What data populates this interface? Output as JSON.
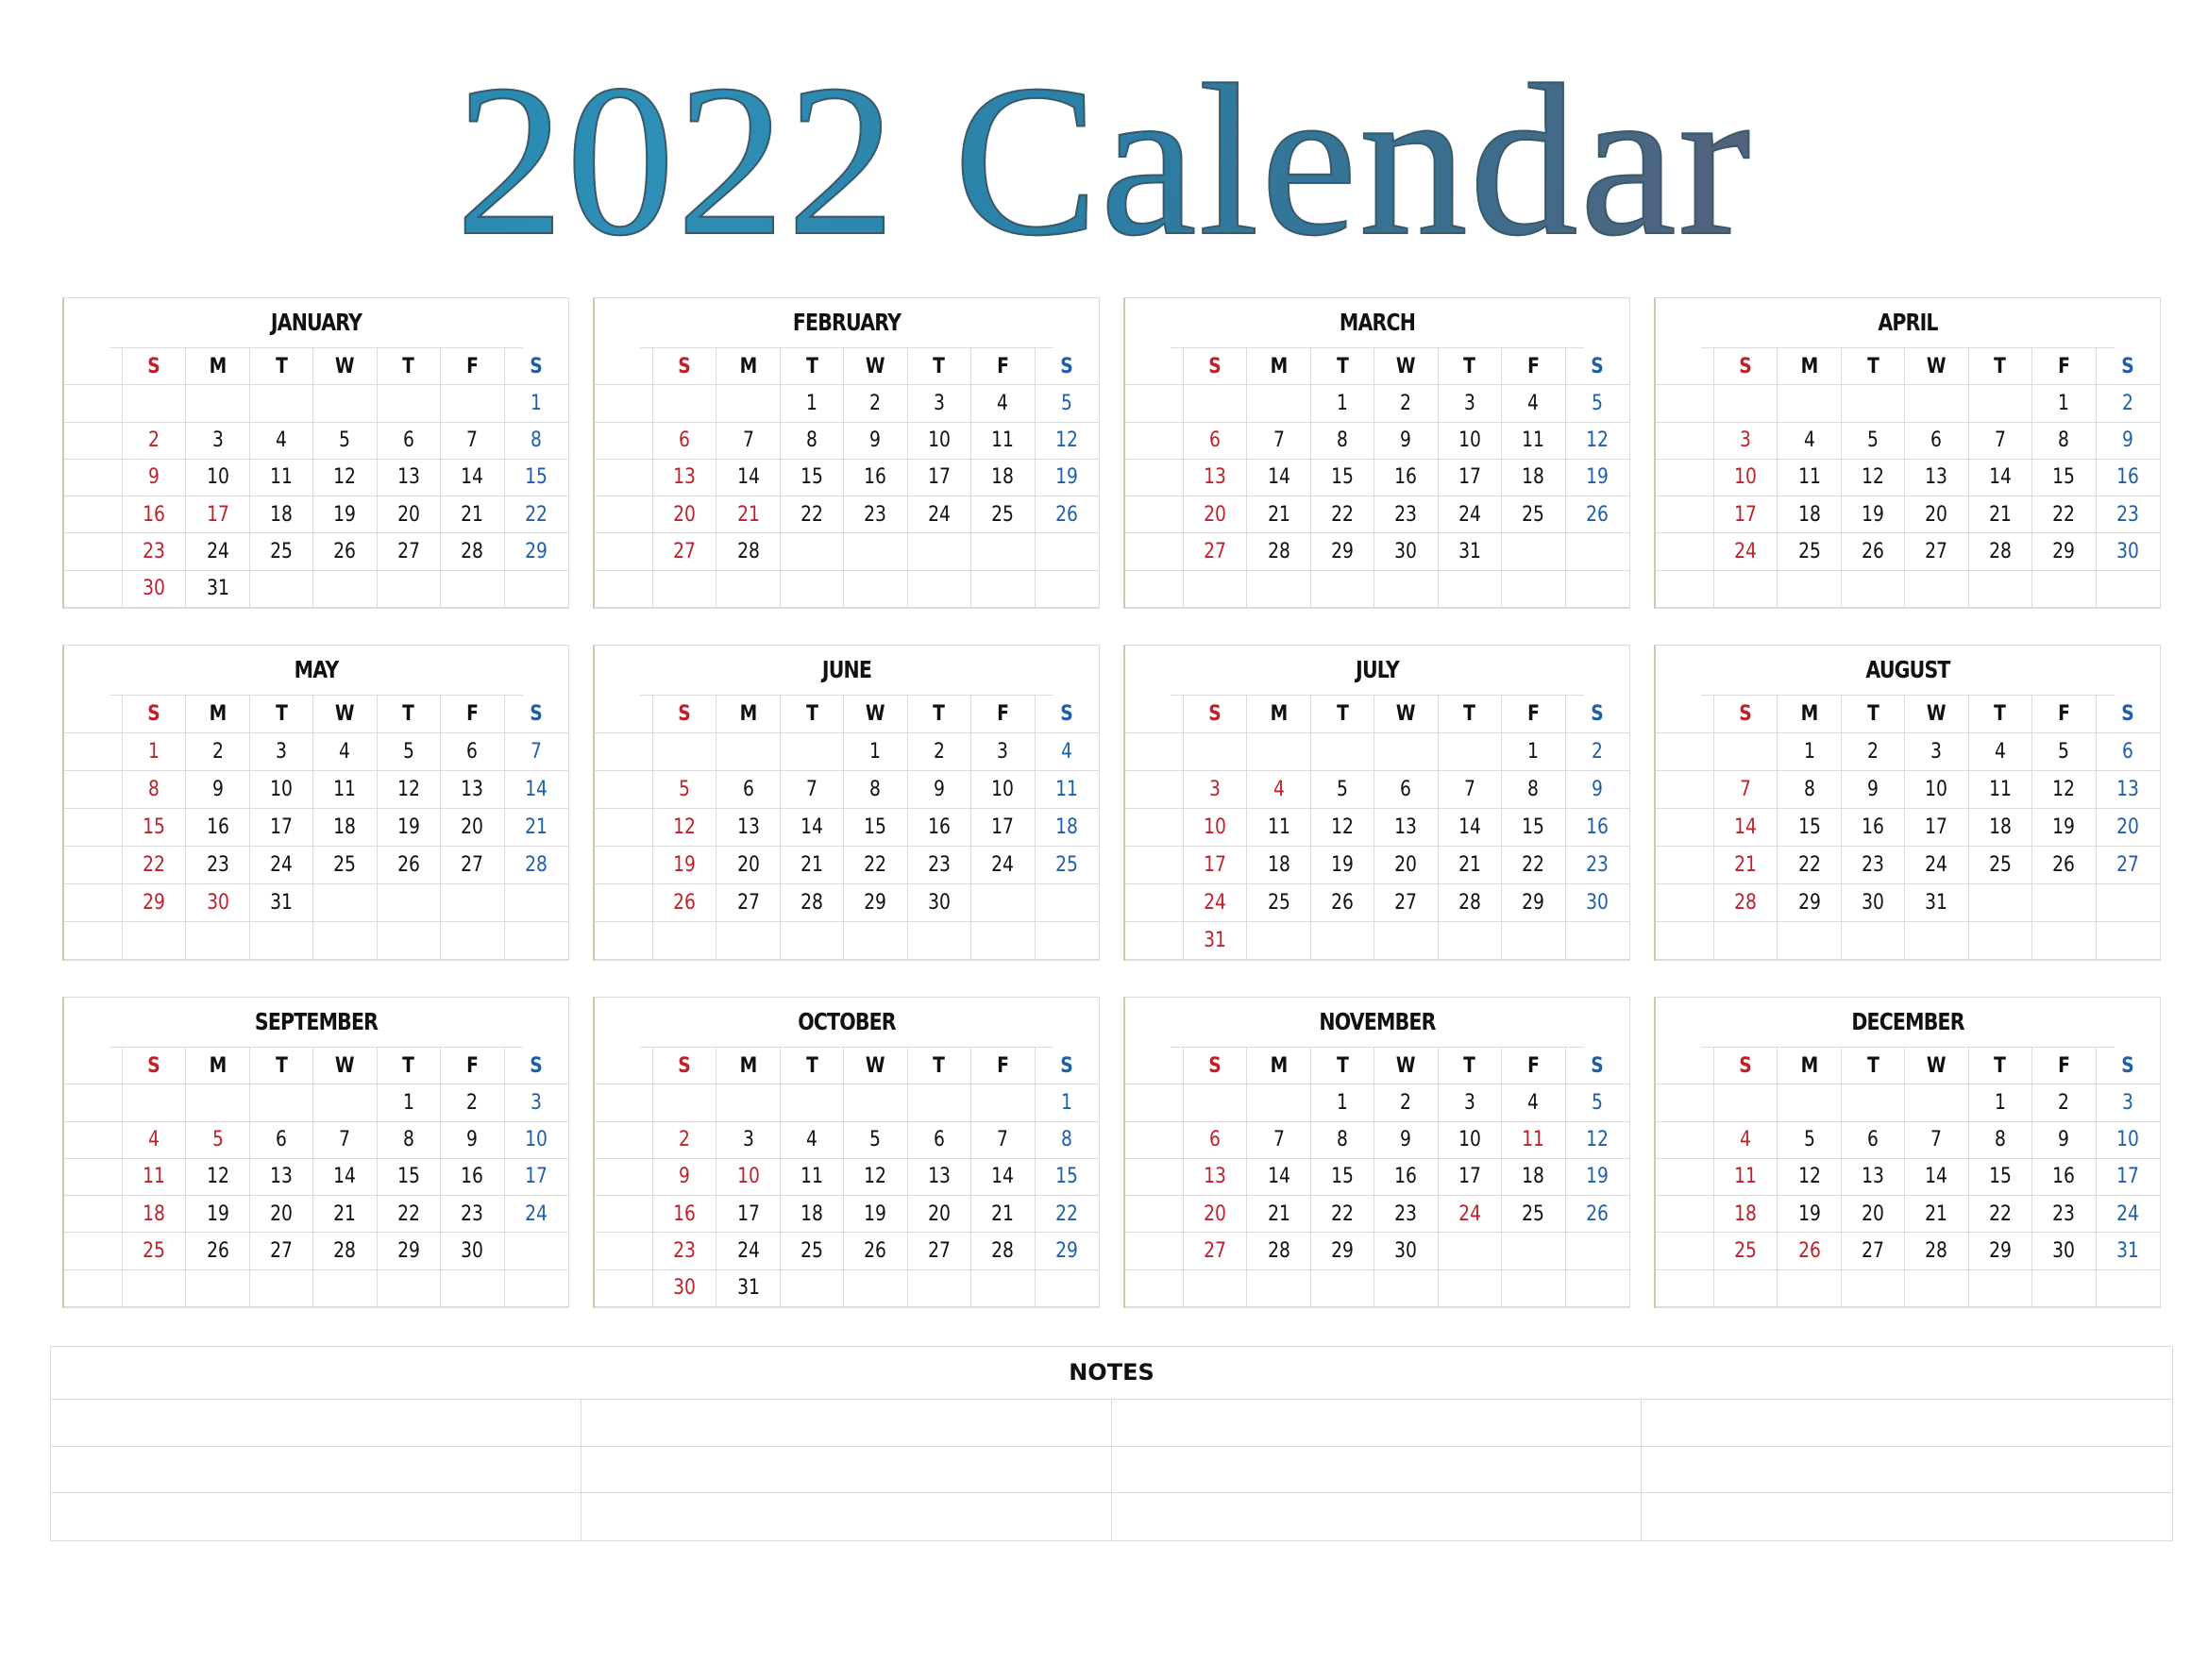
{
  "title": "2022 Calendar",
  "weekday_labels": [
    "S",
    "M",
    "T",
    "W",
    "T",
    "F",
    "S"
  ],
  "colors": {
    "sunday": "#c0202a",
    "saturday": "#1f5fa8",
    "holiday": "#c0202a",
    "text": "#111111",
    "grid_line": "#dcdcdc"
  },
  "notes": {
    "title": "NOTES",
    "columns": 4,
    "rows": 3
  },
  "months": [
    {
      "name": "JANUARY",
      "weeks": [
        [
          "",
          "",
          "",
          "",
          "",
          "",
          "1"
        ],
        [
          "2",
          "3",
          "4",
          "5",
          "6",
          "7",
          "8"
        ],
        [
          "9",
          "10",
          "11",
          "12",
          "13",
          "14",
          "15"
        ],
        [
          "16",
          "17",
          "18",
          "19",
          "20",
          "21",
          "22"
        ],
        [
          "23",
          "24",
          "25",
          "26",
          "27",
          "28",
          "29"
        ],
        [
          "30",
          "31",
          "",
          "",
          "",
          "",
          ""
        ]
      ],
      "red_days": [
        "17"
      ]
    },
    {
      "name": "FEBRUARY",
      "weeks": [
        [
          "",
          "",
          "1",
          "2",
          "3",
          "4",
          "5"
        ],
        [
          "6",
          "7",
          "8",
          "9",
          "10",
          "11",
          "12"
        ],
        [
          "13",
          "14",
          "15",
          "16",
          "17",
          "18",
          "19"
        ],
        [
          "20",
          "21",
          "22",
          "23",
          "24",
          "25",
          "26"
        ],
        [
          "27",
          "28",
          "",
          "",
          "",
          "",
          ""
        ],
        [
          "",
          "",
          "",
          "",
          "",
          "",
          ""
        ]
      ],
      "red_days": [
        "21"
      ]
    },
    {
      "name": "MARCH",
      "weeks": [
        [
          "",
          "",
          "1",
          "2",
          "3",
          "4",
          "5"
        ],
        [
          "6",
          "7",
          "8",
          "9",
          "10",
          "11",
          "12"
        ],
        [
          "13",
          "14",
          "15",
          "16",
          "17",
          "18",
          "19"
        ],
        [
          "20",
          "21",
          "22",
          "23",
          "24",
          "25",
          "26"
        ],
        [
          "27",
          "28",
          "29",
          "30",
          "31",
          "",
          ""
        ],
        [
          "",
          "",
          "",
          "",
          "",
          "",
          ""
        ]
      ],
      "red_days": []
    },
    {
      "name": "APRIL",
      "weeks": [
        [
          "",
          "",
          "",
          "",
          "",
          "1",
          "2"
        ],
        [
          "3",
          "4",
          "5",
          "6",
          "7",
          "8",
          "9"
        ],
        [
          "10",
          "11",
          "12",
          "13",
          "14",
          "15",
          "16"
        ],
        [
          "17",
          "18",
          "19",
          "20",
          "21",
          "22",
          "23"
        ],
        [
          "24",
          "25",
          "26",
          "27",
          "28",
          "29",
          "30"
        ],
        [
          "",
          "",
          "",
          "",
          "",
          "",
          ""
        ]
      ],
      "red_days": []
    },
    {
      "name": "MAY",
      "weeks": [
        [
          "1",
          "2",
          "3",
          "4",
          "5",
          "6",
          "7"
        ],
        [
          "8",
          "9",
          "10",
          "11",
          "12",
          "13",
          "14"
        ],
        [
          "15",
          "16",
          "17",
          "18",
          "19",
          "20",
          "21"
        ],
        [
          "22",
          "23",
          "24",
          "25",
          "26",
          "27",
          "28"
        ],
        [
          "29",
          "30",
          "31",
          "",
          "",
          "",
          ""
        ],
        [
          "",
          "",
          "",
          "",
          "",
          "",
          ""
        ]
      ],
      "red_days": [
        "30"
      ]
    },
    {
      "name": "JUNE",
      "weeks": [
        [
          "",
          "",
          "",
          "1",
          "2",
          "3",
          "4"
        ],
        [
          "5",
          "6",
          "7",
          "8",
          "9",
          "10",
          "11"
        ],
        [
          "12",
          "13",
          "14",
          "15",
          "16",
          "17",
          "18"
        ],
        [
          "19",
          "20",
          "21",
          "22",
          "23",
          "24",
          "25"
        ],
        [
          "26",
          "27",
          "28",
          "29",
          "30",
          "",
          ""
        ],
        [
          "",
          "",
          "",
          "",
          "",
          "",
          ""
        ]
      ],
      "red_days": []
    },
    {
      "name": "JULY",
      "weeks": [
        [
          "",
          "",
          "",
          "",
          "",
          "1",
          "2"
        ],
        [
          "3",
          "4",
          "5",
          "6",
          "7",
          "8",
          "9"
        ],
        [
          "10",
          "11",
          "12",
          "13",
          "14",
          "15",
          "16"
        ],
        [
          "17",
          "18",
          "19",
          "20",
          "21",
          "22",
          "23"
        ],
        [
          "24",
          "25",
          "26",
          "27",
          "28",
          "29",
          "30"
        ],
        [
          "31",
          "",
          "",
          "",
          "",
          "",
          ""
        ]
      ],
      "red_days": [
        "4"
      ]
    },
    {
      "name": "AUGUST",
      "weeks": [
        [
          "",
          "1",
          "2",
          "3",
          "4",
          "5",
          "6"
        ],
        [
          "7",
          "8",
          "9",
          "10",
          "11",
          "12",
          "13"
        ],
        [
          "14",
          "15",
          "16",
          "17",
          "18",
          "19",
          "20"
        ],
        [
          "21",
          "22",
          "23",
          "24",
          "25",
          "26",
          "27"
        ],
        [
          "28",
          "29",
          "30",
          "31",
          "",
          "",
          ""
        ],
        [
          "",
          "",
          "",
          "",
          "",
          "",
          ""
        ]
      ],
      "red_days": []
    },
    {
      "name": "SEPTEMBER",
      "weeks": [
        [
          "",
          "",
          "",
          "",
          "1",
          "2",
          "3"
        ],
        [
          "4",
          "5",
          "6",
          "7",
          "8",
          "9",
          "10"
        ],
        [
          "11",
          "12",
          "13",
          "14",
          "15",
          "16",
          "17"
        ],
        [
          "18",
          "19",
          "20",
          "21",
          "22",
          "23",
          "24"
        ],
        [
          "25",
          "26",
          "27",
          "28",
          "29",
          "30",
          ""
        ],
        [
          "",
          "",
          "",
          "",
          "",
          "",
          ""
        ]
      ],
      "red_days": [
        "5"
      ]
    },
    {
      "name": "OCTOBER",
      "weeks": [
        [
          "",
          "",
          "",
          "",
          "",
          "",
          "1"
        ],
        [
          "2",
          "3",
          "4",
          "5",
          "6",
          "7",
          "8"
        ],
        [
          "9",
          "10",
          "11",
          "12",
          "13",
          "14",
          "15"
        ],
        [
          "16",
          "17",
          "18",
          "19",
          "20",
          "21",
          "22"
        ],
        [
          "23",
          "24",
          "25",
          "26",
          "27",
          "28",
          "29"
        ],
        [
          "30",
          "31",
          "",
          "",
          "",
          "",
          ""
        ]
      ],
      "red_days": [
        "10"
      ]
    },
    {
      "name": "NOVEMBER",
      "weeks": [
        [
          "",
          "",
          "1",
          "2",
          "3",
          "4",
          "5"
        ],
        [
          "6",
          "7",
          "8",
          "9",
          "10",
          "11",
          "12"
        ],
        [
          "13",
          "14",
          "15",
          "16",
          "17",
          "18",
          "19"
        ],
        [
          "20",
          "21",
          "22",
          "23",
          "24",
          "25",
          "26"
        ],
        [
          "27",
          "28",
          "29",
          "30",
          "",
          "",
          ""
        ],
        [
          "",
          "",
          "",
          "",
          "",
          "",
          ""
        ]
      ],
      "red_days": [
        "11",
        "24"
      ]
    },
    {
      "name": "DECEMBER",
      "weeks": [
        [
          "",
          "",
          "",
          "",
          "1",
          "2",
          "3"
        ],
        [
          "4",
          "5",
          "6",
          "7",
          "8",
          "9",
          "10"
        ],
        [
          "11",
          "12",
          "13",
          "14",
          "15",
          "16",
          "17"
        ],
        [
          "18",
          "19",
          "20",
          "21",
          "22",
          "23",
          "24"
        ],
        [
          "25",
          "26",
          "27",
          "28",
          "29",
          "30",
          "31"
        ],
        [
          "",
          "",
          "",
          "",
          "",
          "",
          ""
        ]
      ],
      "red_days": [
        "26"
      ]
    }
  ]
}
